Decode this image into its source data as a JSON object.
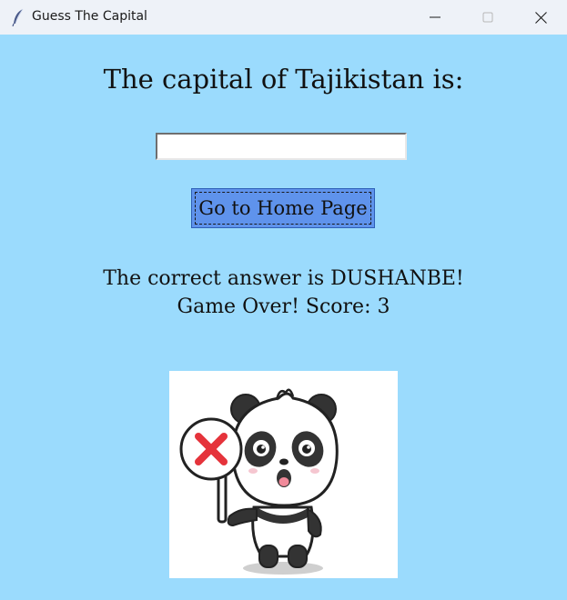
{
  "window": {
    "title": "Guess The Capital",
    "icon": "feather-icon",
    "controls": [
      "minimize-icon",
      "maximize-icon",
      "close-icon"
    ]
  },
  "quiz": {
    "question": "The capital of Tajikistan is:",
    "answer_value": "",
    "button_label": "Go to Home Page",
    "result_message": "The correct answer is DUSHANBE!",
    "score_message": "Game Over! Score: 3"
  },
  "illustration": {
    "icon": "sad-panda-wrong-sign-icon"
  },
  "colors": {
    "background": "#9bdbfd",
    "titlebar": "#eef2f8",
    "button": "#5f93ec",
    "wrong_mark": "#e5333b"
  }
}
